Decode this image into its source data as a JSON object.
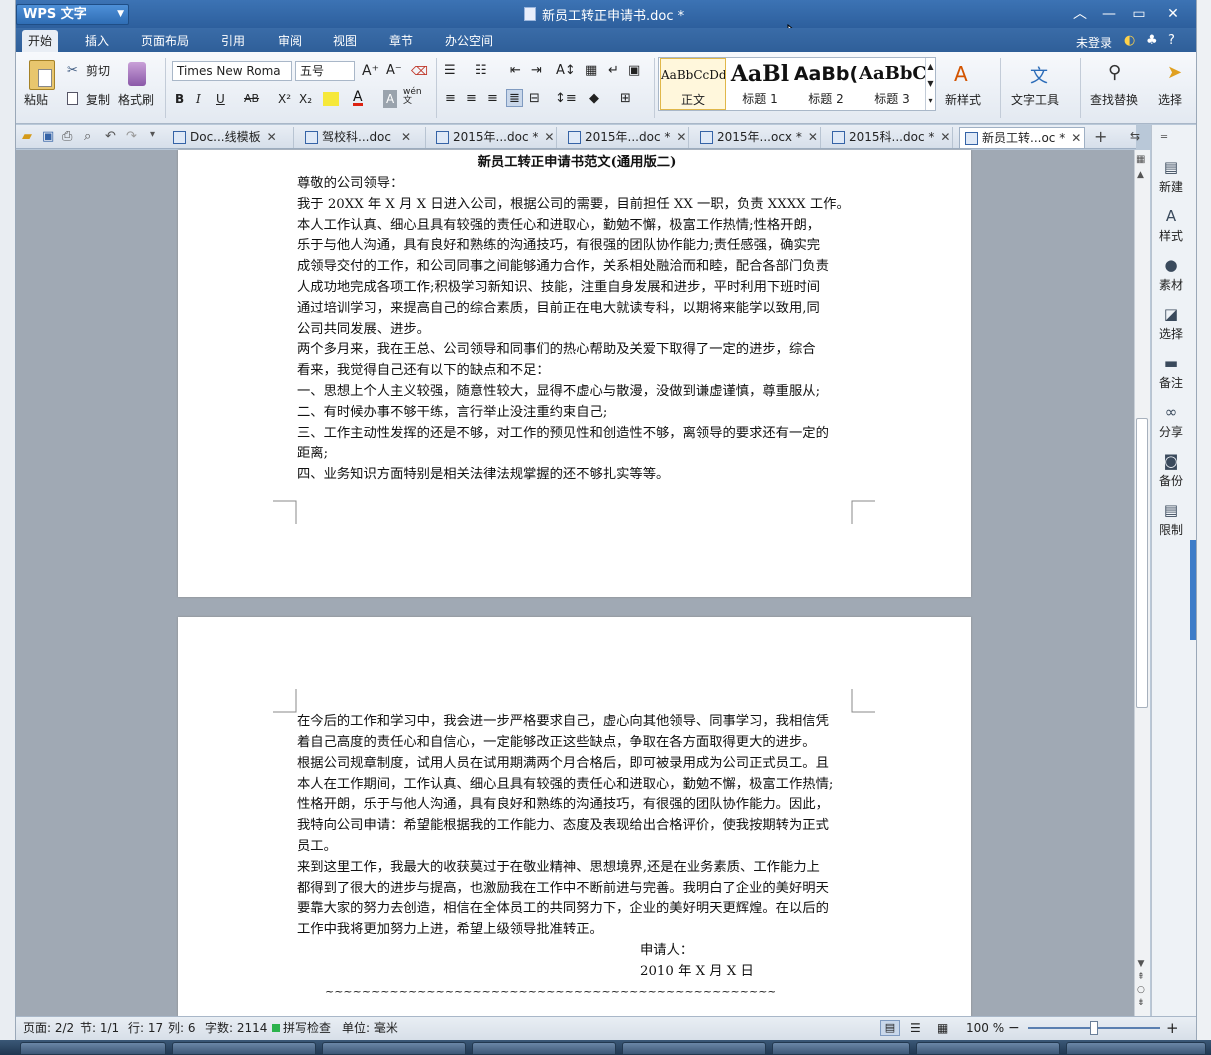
{
  "app": {
    "name": "WPS 文字",
    "doc_title": "新员工转正申请书.doc *"
  },
  "window": {
    "login": "未登录",
    "help": "?"
  },
  "menu": {
    "tabs": [
      "开始",
      "插入",
      "页面布局",
      "引用",
      "审阅",
      "视图",
      "章节",
      "办公空间"
    ],
    "active": "开始"
  },
  "ribbon": {
    "paste": "粘贴",
    "cut": "剪切",
    "copy": "复制",
    "format_painter": "格式刷",
    "font_name": "Times New Roma",
    "font_size": "五号",
    "bold": "B",
    "italic": "I",
    "underline": "U",
    "strike": "AB",
    "superscript": "X²",
    "subscript": "X₂",
    "font_color": "A",
    "char_shade": "A",
    "phonetic": "wén 文",
    "styles": [
      {
        "preview": "AaBbCcDd",
        "label": "正文"
      },
      {
        "preview": "AaBl",
        "label": "标题 1"
      },
      {
        "preview": "AaBb(",
        "label": "标题 2"
      },
      {
        "preview": "AaBbC",
        "label": "标题 3"
      }
    ],
    "new_style": "新样式",
    "text_tools": "文字工具",
    "find_replace": "查找替换",
    "select": "选择"
  },
  "doc_tabs": [
    {
      "label": "Doc...线模板",
      "active": false
    },
    {
      "label": "驾校科...doc",
      "active": false
    },
    {
      "label": "2015年...doc *",
      "active": false
    },
    {
      "label": "2015年...doc *",
      "active": false
    },
    {
      "label": "2015年...ocx *",
      "active": false
    },
    {
      "label": "2015科...doc *",
      "active": false
    },
    {
      "label": "新员工转...oc *",
      "active": true
    }
  ],
  "document": {
    "page1_lines": [
      "新员工转正申请书范文(通用版二)",
      "尊敬的公司领导：",
      "我于 20XX 年 X 月 X 日进入公司，根据公司的需要，目前担任 XX 一职，负责 XXXX 工作。",
      "本人工作认真、细心且具有较强的责任心和进取心，勤勉不懈，极富工作热情;性格开朗，",
      "乐于与他人沟通，具有良好和熟练的沟通技巧，有很强的团队协作能力;责任感强，确实完",
      "成领导交付的工作，和公司同事之间能够通力合作，关系相处融洽而和睦，配合各部门负责",
      "人成功地完成各项工作;积极学习新知识、技能，注重自身发展和进步，平时利用下班时间",
      "通过培训学习，来提高自己的综合素质，目前正在电大就读专科，以期将来能学以致用,同",
      "公司共同发展、进步。",
      " 两个多月来，我在王总、公司领导和同事们的热心帮助及关爱下取得了一定的进步，综合",
      "看来，我觉得自己还有以下的缺点和不足：",
      "一、思想上个人主义较强，随意性较大，显得不虚心与散漫，没做到谦虚谨慎，尊重服从;",
      "二、有时候办事不够干练，言行举止没注重约束自己;",
      "三、工作主动性发挥的还是不够，对工作的预见性和创造性不够，离领导的要求还有一定的",
      "距离;",
      "四、业务知识方面特别是相关法律法规掌握的还不够扎实等等。"
    ],
    "page2_lines": [
      "在今后的工作和学习中，我会进一步严格要求自己，虚心向其他领导、同事学习，我相信凭",
      "着自己高度的责任心和自信心，一定能够改正这些缺点，争取在各方面取得更大的进步。",
      "根据公司规章制度，试用人员在试用期满两个月合格后，即可被录用成为公司正式员工。且",
      "本人在工作期间，工作认真、细心且具有较强的责任心和进取心，勤勉不懈，极富工作热情;",
      "性格开朗，乐于与他人沟通，具有良好和熟练的沟通技巧，有很强的团队协作能力。因此，",
      "我特向公司申请：希望能根据我的工作能力、态度及表现给出合格评价，使我按期转为正式",
      "员工。",
      "来到这里工作，我最大的收获莫过于在敬业精神、思想境界,还是在业务素质、工作能力上",
      "都得到了很大的进步与提高，也激励我在工作中不断前进与完善。我明白了企业的美好明天",
      "要靠大家的努力去创造，相信在全体员工的共同努力下，企业的美好明天更辉煌。在以后的",
      "工作中我将更加努力上进，希望上级领导批准转正。"
    ],
    "applicant": "申请人：",
    "date": "2010 年 X 月 X 日",
    "tilde": "~~~~~~~~~~~~~~~~~~~~~~~~~~~~~~~~~~~~~~~~~~~~~~~~~~~~~~~~~~~~~~~~~~~~~~~~~~"
  },
  "side_panel": [
    "新建",
    "样式",
    "素材",
    "选择",
    "备注",
    "分享",
    "备份",
    "限制"
  ],
  "status": {
    "page": "页面: 2/2",
    "section": "节: 1/1",
    "row": "行: 17",
    "col": "列: 6",
    "words": "字数: 2114",
    "spell": "拼写检查",
    "unit": "单位: 毫米",
    "zoom": "100 %"
  },
  "colors": {
    "title_bar": "#2d5f9d",
    "ribbon": "#e3e9f1",
    "workspace": "#a0a9b4"
  }
}
